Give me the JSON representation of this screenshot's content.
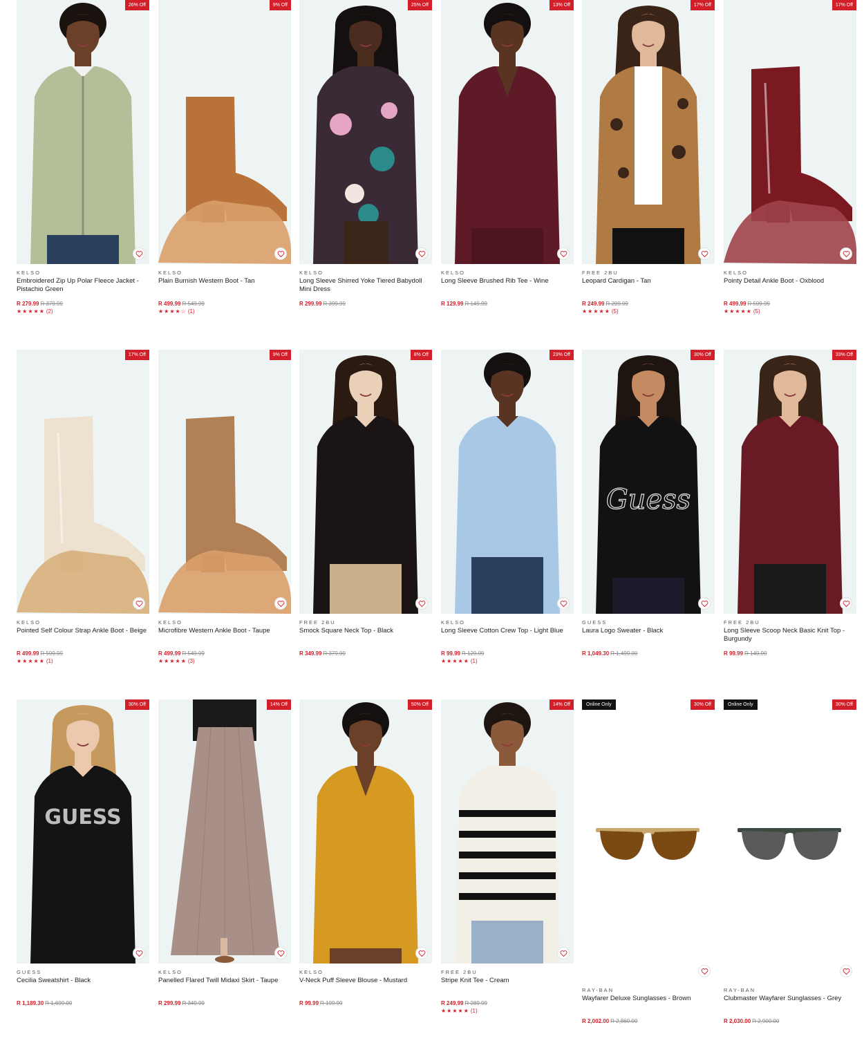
{
  "products": [
    {
      "brand": "KELSO",
      "name": "Embroidered Zip Up Polar Fleece Jacket - Pistachio Green",
      "price": "R 279.99",
      "was": "R 379.99",
      "discount": "26% Off",
      "stars": "★★★★★",
      "reviews": "(2)",
      "online": "",
      "image": "woman-green-fleece-jacket"
    },
    {
      "brand": "KELSO",
      "name": "Plain Burnish Western Boot - Tan",
      "price": "R 499.99",
      "was": "R 549.99",
      "discount": "9% Off",
      "stars": "★★★★☆",
      "reviews": "(1)",
      "online": "",
      "image": "tan-western-boot"
    },
    {
      "brand": "KELSO",
      "name": "Long Sleeve Shirred Yoke Tiered Babydoll Mini Dress",
      "price": "R 299.99",
      "was": "R 399.99",
      "discount": "25% Off",
      "stars": "",
      "reviews": "",
      "online": "",
      "image": "woman-floral-mini-dress"
    },
    {
      "brand": "KELSO",
      "name": "Long Sleeve Brushed Rib Tee - Wine",
      "price": "R 129.99",
      "was": "R 149.99",
      "discount": "13% Off",
      "stars": "",
      "reviews": "",
      "online": "",
      "image": "woman-wine-rib-tee"
    },
    {
      "brand": "FREE 2BU",
      "name": "Leopard Cardigan - Tan",
      "price": "R 249.99",
      "was": "R 299.99",
      "discount": "17% Off",
      "stars": "★★★★★",
      "reviews": "(5)",
      "online": "",
      "image": "woman-leopard-cardigan"
    },
    {
      "brand": "KELSO",
      "name": "Pointy Detail Ankle Boot - Oxblood",
      "price": "R 499.99",
      "was": "R 599.99",
      "discount": "17% Off",
      "stars": "★★★★★",
      "reviews": "(5)",
      "online": "",
      "image": "oxblood-ankle-boot"
    },
    {
      "brand": "KELSO",
      "name": "Pointed Self Colour Strap Ankle Boot - Beige",
      "price": "R 499.99",
      "was": "R 599.99",
      "discount": "17% Off",
      "stars": "★★★★★",
      "reviews": "(1)",
      "online": "",
      "image": "beige-ankle-boot"
    },
    {
      "brand": "KELSO",
      "name": "Microfibre Western Ankle Boot - Taupe",
      "price": "R 499.99",
      "was": "R 549.99",
      "discount": "9% Off",
      "stars": "★★★★★",
      "reviews": "(3)",
      "online": "",
      "image": "taupe-western-boot"
    },
    {
      "brand": "FREE 2BU",
      "name": "Smock Square Neck Top - Black",
      "price": "R 349.99",
      "was": "R 379.99",
      "discount": "8% Off",
      "stars": "",
      "reviews": "",
      "online": "",
      "image": "woman-black-smock-top"
    },
    {
      "brand": "KELSO",
      "name": "Long Sleeve Cotton Crew Top - Light Blue",
      "price": "R 99.99",
      "was": "R 129.99",
      "discount": "23% Off",
      "stars": "★★★★★",
      "reviews": "(1)",
      "online": "",
      "image": "woman-light-blue-top"
    },
    {
      "brand": "GUESS",
      "name": "Laura Logo Sweater - Black",
      "price": "R 1,049.30",
      "was": "R 1,499.00",
      "discount": "30% Off",
      "stars": "",
      "reviews": "",
      "online": "",
      "image": "woman-guess-sweater"
    },
    {
      "brand": "FREE 2BU",
      "name": "Long Sleeve Scoop Neck Basic Knit Top - Burgundy",
      "price": "R 99.99",
      "was": "R 149.99",
      "discount": "33% Off",
      "stars": "",
      "reviews": "",
      "online": "",
      "image": "woman-burgundy-knit-top"
    },
    {
      "brand": "GUESS",
      "name": "Cecilia Sweatshirt - Black",
      "price": "R 1,189.30",
      "was": "R 1,699.00",
      "discount": "30% Off",
      "stars": "",
      "reviews": "",
      "online": "",
      "image": "woman-guess-sweatshirt"
    },
    {
      "brand": "KELSO",
      "name": "Panelled Flared Twill Midaxi Skirt - Taupe",
      "price": "R 299.99",
      "was": "R 349.99",
      "discount": "14% Off",
      "stars": "",
      "reviews": "",
      "online": "",
      "image": "taupe-midaxi-skirt"
    },
    {
      "brand": "KELSO",
      "name": "V-Neck Puff Sleeve Blouse - Mustard",
      "price": "R 99.99",
      "was": "R 199.99",
      "discount": "50% Off",
      "stars": "",
      "reviews": "",
      "online": "",
      "image": "woman-mustard-blouse"
    },
    {
      "brand": "FREE 2BU",
      "name": "Stripe Knit Tee - Cream",
      "price": "R 249.99",
      "was": "R 289.99",
      "discount": "14% Off",
      "stars": "★★★★★",
      "reviews": "(1)",
      "online": "",
      "image": "woman-stripe-knit-tee"
    },
    {
      "brand": "RAY-BAN",
      "name": "Wayfarer Deluxe Sunglasses - Brown",
      "price": "R 2,002.00",
      "was": "R 2,860.00",
      "discount": "30% Off",
      "stars": "",
      "reviews": "",
      "online": "Online Only",
      "image": "brown-sunglasses"
    },
    {
      "brand": "RAY-BAN",
      "name": "Clubmaster Wayfarer Sunglasses - Grey",
      "price": "R 2,030.00",
      "was": "R 2,900.00",
      "discount": "30% Off",
      "stars": "",
      "reviews": "",
      "online": "Online Only",
      "image": "grey-sunglasses"
    }
  ],
  "icons": {
    "wishlist": "heart-icon"
  },
  "colors": {
    "accent": "#d31f2a",
    "image_bg": "#eef4f3"
  }
}
